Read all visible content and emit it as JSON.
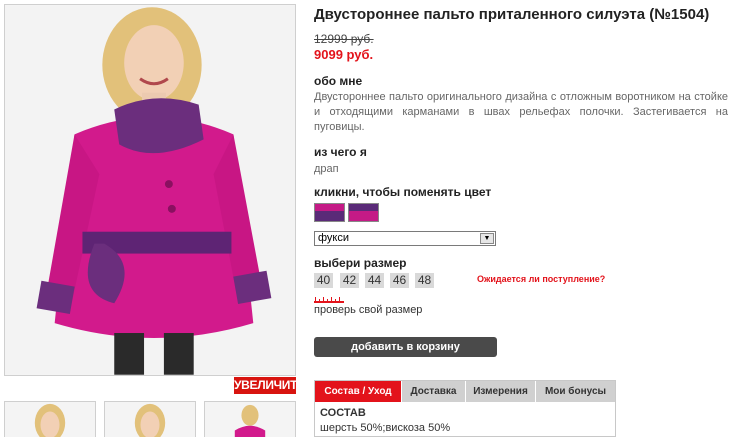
{
  "product": {
    "title": "Двустороннее пальто приталенного силуэта (№1504)",
    "old_price": "12999 руб.",
    "new_price": "9099 руб."
  },
  "gallery": {
    "zoom_label": "УВЕЛИЧИТЬ"
  },
  "about": {
    "label": "обо мне",
    "text": "Двустороннее пальто оригинального дизайна с отложным воротником на стойке и отходящими карманами в швах рельефах полочки. Застегивается на пуговицы."
  },
  "material": {
    "label": "из чего я",
    "value": "драп"
  },
  "colors": {
    "label": "кликни, чтобы поменять цвет",
    "swatches": [
      {
        "main": "#5a2a78",
        "accent": "#c41a86"
      },
      {
        "main": "#c41a86",
        "accent": "#5a2a78"
      }
    ],
    "selected": "фукси"
  },
  "sizes": {
    "label": "выбери размер",
    "options": [
      "40",
      "42",
      "44",
      "46",
      "48"
    ],
    "notify_label": "Ожидается ли поступление?",
    "check_label": "проверь свой размер"
  },
  "cart": {
    "button_label": "добавить в корзину"
  },
  "tabs": {
    "items": [
      "Состав / Уход",
      "Доставка",
      "Измерения",
      "Мои бонусы"
    ],
    "active": 0,
    "content_heading": "СОСТАВ",
    "content_text": "шерсть 50%;вискоза 50%"
  },
  "palette": {
    "accent": "#e3131b",
    "coat": "#d21a8c",
    "collar": "#6b2e7d"
  }
}
